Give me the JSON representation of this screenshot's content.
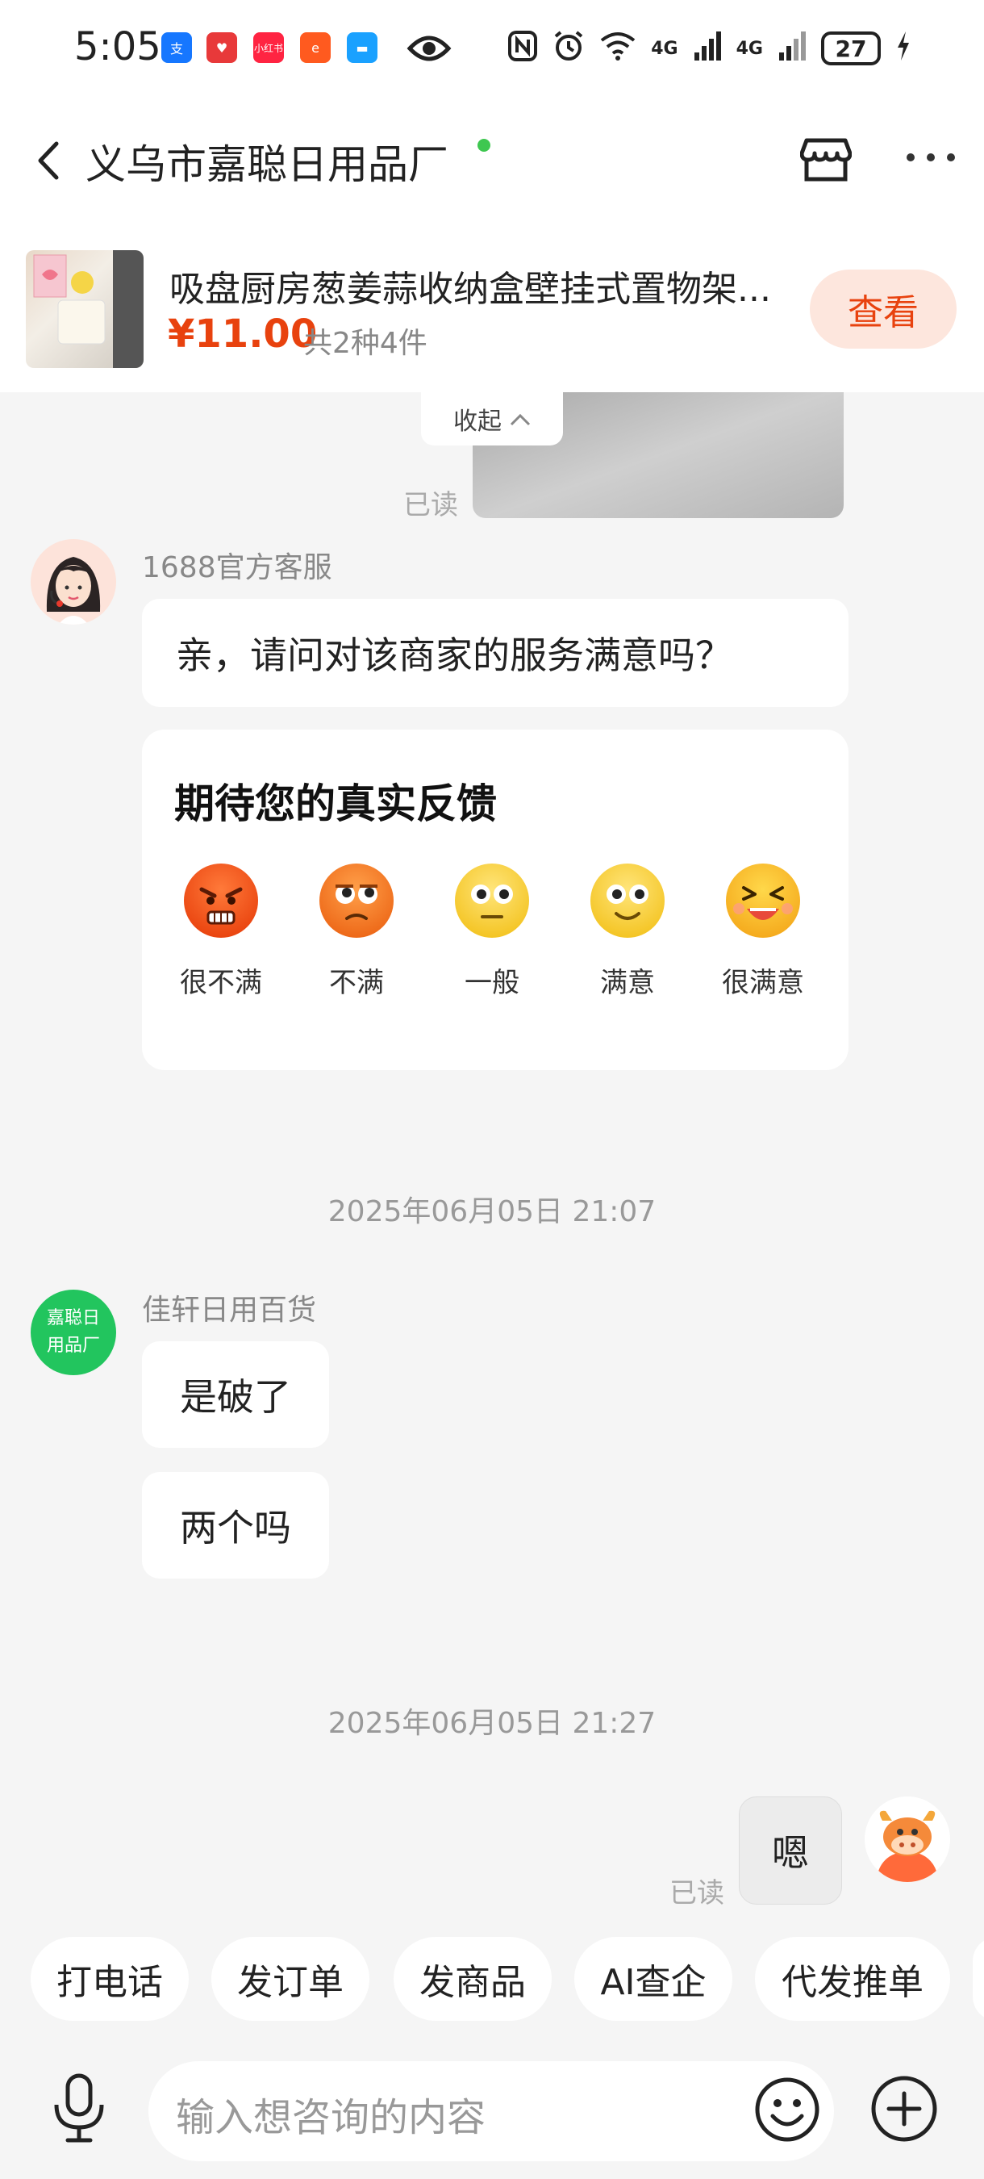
{
  "status_bar": {
    "time": "5:05",
    "network_1": "4G",
    "network_2": "4G",
    "battery": "27"
  },
  "header": {
    "title": "义乌市嘉聪日用品厂"
  },
  "product": {
    "name": "吸盘厨房葱姜蒜收纳盒壁挂式置物架...",
    "price": "¥11.00",
    "count": "共2种4件",
    "view_label": "查看"
  },
  "chat": {
    "collapse_label": "收起",
    "read_label": "已读",
    "service_sender": "1688官方客服",
    "service_message": "亲，请问对该商家的服务满意吗？",
    "feedback_title": "期待您的真实反馈",
    "ratings": [
      "很不满",
      "不满",
      "一般",
      "满意",
      "很满意"
    ],
    "timestamp_1": "2025年06月05日 21:07",
    "seller_avatar_text": "嘉聪日用品厂",
    "seller_sender": "佳轩日用百货",
    "seller_messages": [
      "是破了",
      "两个吗"
    ],
    "timestamp_2": "2025年06月05日 21:27",
    "my_message": "嗯",
    "my_read_label": "已读"
  },
  "quick_actions": [
    "打电话",
    "发订单",
    "发商品",
    "AI查企",
    "代发推单"
  ],
  "input": {
    "placeholder": "输入想咨询的内容"
  }
}
